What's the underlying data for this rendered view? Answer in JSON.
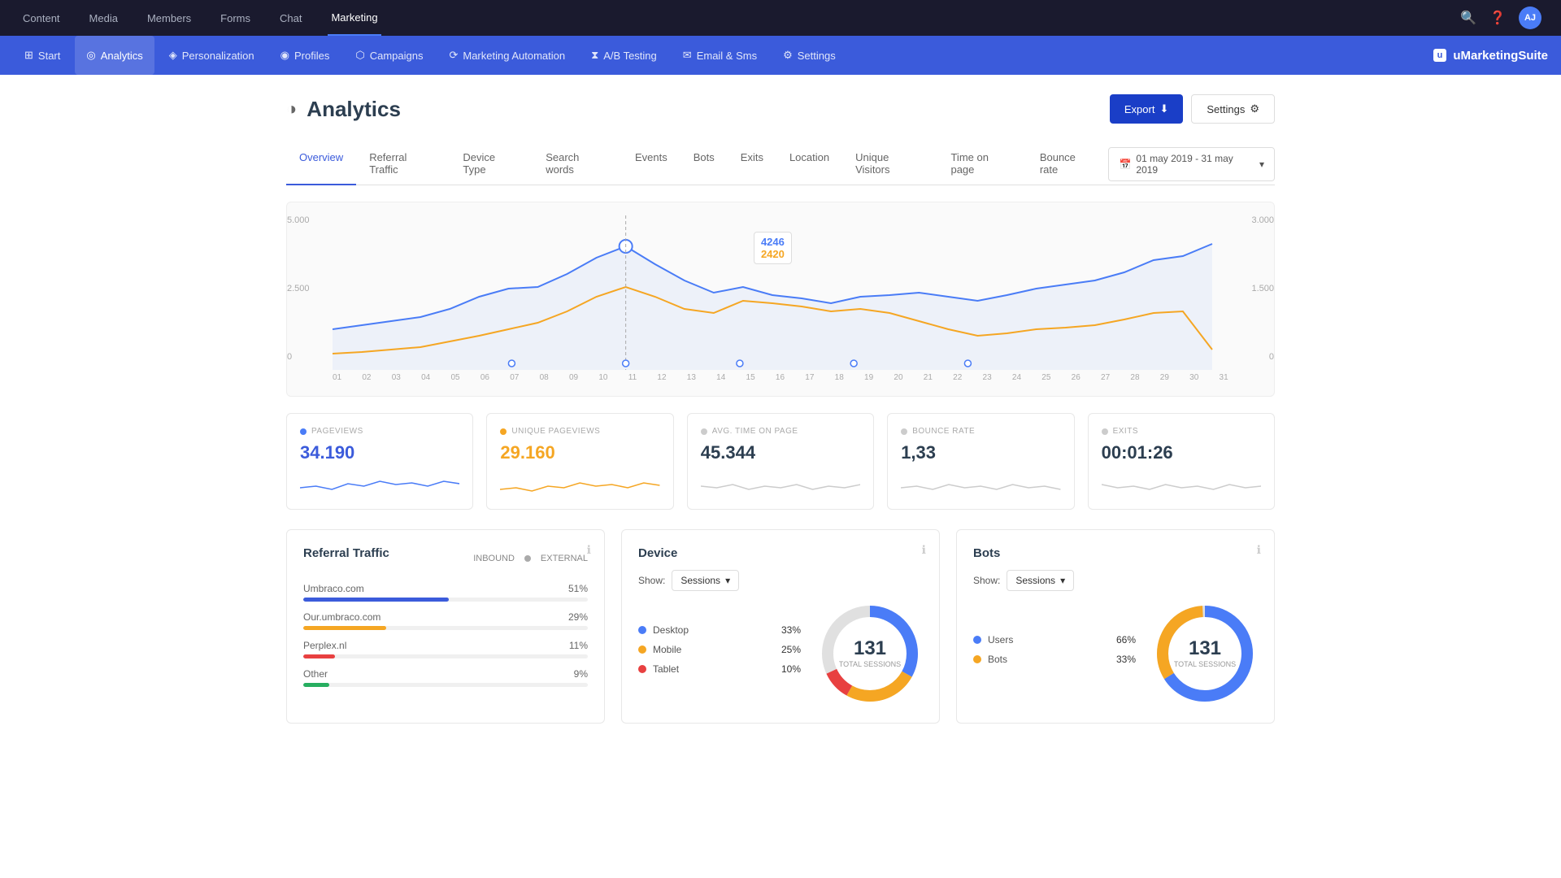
{
  "topnav": {
    "items": [
      {
        "label": "Content",
        "active": false
      },
      {
        "label": "Media",
        "active": false
      },
      {
        "label": "Members",
        "active": false
      },
      {
        "label": "Forms",
        "active": false
      },
      {
        "label": "Chat",
        "active": false
      },
      {
        "label": "Marketing",
        "active": true
      }
    ],
    "icons": [
      "search",
      "help",
      "user"
    ],
    "avatar_label": "AJ"
  },
  "secnav": {
    "items": [
      {
        "label": "Start",
        "icon": "⊞",
        "active": false
      },
      {
        "label": "Analytics",
        "icon": "◎",
        "active": true
      },
      {
        "label": "Personalization",
        "icon": "◈",
        "active": false
      },
      {
        "label": "Profiles",
        "icon": "◉",
        "active": false
      },
      {
        "label": "Campaigns",
        "icon": "⬡",
        "active": false
      },
      {
        "label": "Marketing Automation",
        "icon": "⟳",
        "active": false
      },
      {
        "label": "A/B Testing",
        "icon": "⧗",
        "active": false
      },
      {
        "label": "Email & Sms",
        "icon": "✉",
        "active": false
      },
      {
        "label": "Settings",
        "icon": "⚙",
        "active": false
      }
    ],
    "logo": "uMarketingSuite",
    "logo_prefix": "u"
  },
  "page": {
    "title": "Analytics",
    "export_button": "Export",
    "settings_button": "Settings"
  },
  "tabs": [
    {
      "label": "Overview",
      "active": true
    },
    {
      "label": "Referral Traffic",
      "active": false
    },
    {
      "label": "Device Type",
      "active": false
    },
    {
      "label": "Search words",
      "active": false
    },
    {
      "label": "Events",
      "active": false
    },
    {
      "label": "Bots",
      "active": false
    },
    {
      "label": "Exits",
      "active": false
    },
    {
      "label": "Location",
      "active": false
    },
    {
      "label": "Unique Visitors",
      "active": false
    },
    {
      "label": "Time on page",
      "active": false
    },
    {
      "label": "Bounce rate",
      "active": false
    }
  ],
  "date_range": "01 may 2019 - 31 may 2019",
  "chart": {
    "y_labels_left": [
      "5.000",
      "2.500",
      "0"
    ],
    "y_labels_right": [
      "3.000",
      "1.500",
      "0"
    ],
    "x_labels": [
      "01",
      "02",
      "03",
      "04",
      "05",
      "06",
      "07",
      "08",
      "09",
      "10",
      "11",
      "12",
      "13",
      "14",
      "15",
      "16",
      "17",
      "18",
      "19",
      "20",
      "21",
      "22",
      "23",
      "24",
      "25",
      "26",
      "27",
      "28",
      "29",
      "30",
      "31"
    ],
    "tooltip_value1": "4246",
    "tooltip_value2": "2420"
  },
  "metrics": [
    {
      "label": "PAGEVIEWS",
      "dot": "blue",
      "value": "34.190",
      "color": "blue"
    },
    {
      "label": "UNIQUE PAGEVIEWS",
      "dot": "gold",
      "value": "29.160",
      "color": "gold"
    },
    {
      "label": "AVG. TIME ON PAGE",
      "dot": "gray",
      "value": "45.344",
      "color": "dark"
    },
    {
      "label": "BOUNCE RATE",
      "dot": "gray",
      "value": "1,33",
      "color": "dark"
    },
    {
      "label": "EXITS",
      "dot": "gray",
      "value": "00:01:26",
      "color": "dark"
    }
  ],
  "referral_traffic": {
    "title": "Referral Traffic",
    "inbound_label": "INBOUND",
    "external_label": "EXTERNAL",
    "rows": [
      {
        "label": "Umbraco.com",
        "percent": "51%",
        "width": 51,
        "color": "blue"
      },
      {
        "label": "Our.umbraco.com",
        "percent": "29%",
        "width": 29,
        "color": "gold"
      },
      {
        "label": "Perplex.nl",
        "percent": "11%",
        "width": 11,
        "color": "red"
      },
      {
        "label": "Other",
        "percent": "9%",
        "width": 9,
        "color": "green"
      }
    ]
  },
  "device": {
    "title": "Device",
    "show_label": "Show:",
    "show_value": "Sessions",
    "items": [
      {
        "label": "Desktop",
        "percent": "33%",
        "dot_color": "#4a7cf7"
      },
      {
        "label": "Mobile",
        "percent": "25%",
        "dot_color": "#f5a623"
      },
      {
        "label": "Tablet",
        "percent": "10%",
        "dot_color": "#e84040"
      }
    ],
    "donut_value": "131",
    "donut_sub": "TOTAL SESSIONS",
    "donut_segments": [
      {
        "percent": 33,
        "color": "#4a7cf7"
      },
      {
        "percent": 25,
        "color": "#f5a623"
      },
      {
        "percent": 10,
        "color": "#e84040"
      },
      {
        "percent": 32,
        "color": "#e0e0e0"
      }
    ]
  },
  "bots": {
    "title": "Bots",
    "show_label": "Show:",
    "show_value": "Sessions",
    "items": [
      {
        "label": "Users",
        "percent": "66%",
        "dot_color": "#4a7cf7"
      },
      {
        "label": "Bots",
        "percent": "33%",
        "dot_color": "#f5a623"
      }
    ],
    "donut_value": "131",
    "donut_sub": "TOTAL SESSIONS",
    "donut_segments": [
      {
        "percent": 66,
        "color": "#4a7cf7"
      },
      {
        "percent": 33,
        "color": "#f5a623"
      },
      {
        "percent": 1,
        "color": "#e0e0e0"
      }
    ]
  }
}
